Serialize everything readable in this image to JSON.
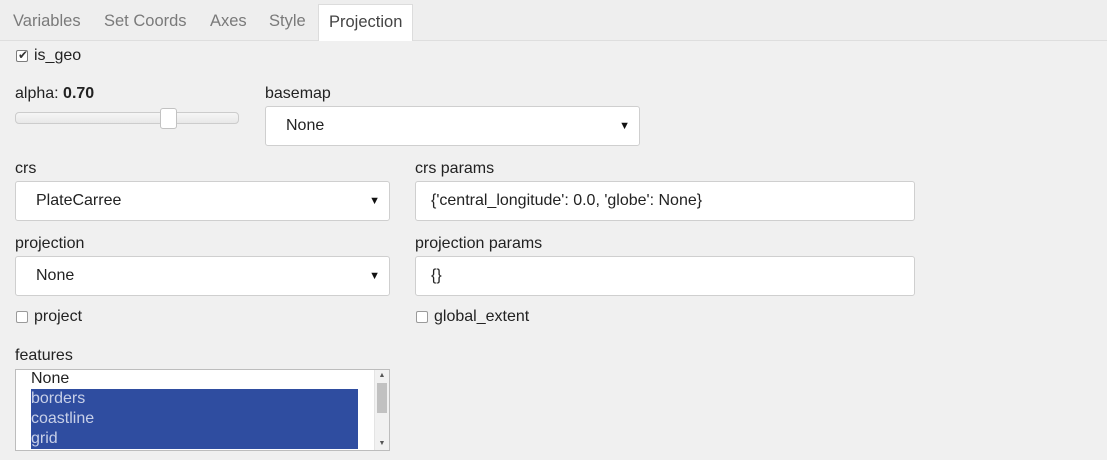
{
  "tabs": [
    {
      "label": "Variables"
    },
    {
      "label": "Set Coords"
    },
    {
      "label": "Axes"
    },
    {
      "label": "Style"
    },
    {
      "label": "Projection",
      "active": true
    }
  ],
  "is_geo": {
    "label": "is_geo",
    "checked": true
  },
  "alpha": {
    "label": "alpha:",
    "value": "0.70",
    "fraction": 0.7
  },
  "basemap": {
    "label": "basemap",
    "value": "None"
  },
  "crs": {
    "label": "crs",
    "value": "PlateCarree"
  },
  "crs_params": {
    "label": "crs params",
    "value": "{'central_longitude': 0.0, 'globe': None}"
  },
  "projection": {
    "label": "projection",
    "value": "None"
  },
  "projection_params": {
    "label": "projection params",
    "value": "{}"
  },
  "project": {
    "label": "project",
    "checked": false
  },
  "global_extent": {
    "label": "global_extent",
    "checked": false
  },
  "features": {
    "label": "features",
    "items": [
      {
        "label": "None",
        "selected": false
      },
      {
        "label": "borders",
        "selected": true
      },
      {
        "label": "coastline",
        "selected": true
      },
      {
        "label": "grid",
        "selected": true
      }
    ]
  },
  "colors": {
    "accent": "#2f4da0",
    "background": "#f0f0f0"
  }
}
